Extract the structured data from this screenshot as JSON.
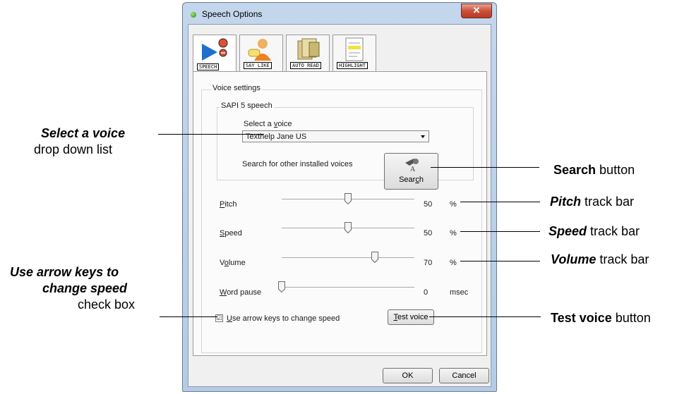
{
  "window": {
    "title": "Speech Options",
    "close_glyph": "✕"
  },
  "tabs": [
    {
      "label": "SPEECH",
      "icon": "speech-tab-icon",
      "active": true
    },
    {
      "label": "SAY LIKE",
      "icon": "say-like-tab-icon",
      "active": false
    },
    {
      "label": "AUTO READ",
      "icon": "auto-read-tab-icon",
      "active": false
    },
    {
      "label": "HIGHLIGHT",
      "icon": "highlight-tab-icon",
      "active": false
    }
  ],
  "voice_settings": {
    "group_label": "Voice settings",
    "sapi_label": "SAPI 5 speech",
    "select_label_pre": "Select a ",
    "select_label_key": "v",
    "select_label_post": "oice",
    "selected_voice": "Texthelp Jane US",
    "search_prompt": "Search for other installed voices",
    "search_button_pre": "Sear",
    "search_button_key": "c",
    "search_button_post": "h"
  },
  "sliders": [
    {
      "key": "P",
      "rest": "itch",
      "value": "50",
      "unit": "%",
      "level_percent": 50
    },
    {
      "key": "S",
      "rest": "peed",
      "value": "50",
      "unit": "%",
      "level_percent": 50
    },
    {
      "pre": "V",
      "key": "o",
      "rest": "lume",
      "value": "70",
      "unit": "%",
      "level_percent": 70
    },
    {
      "key": "W",
      "rest": "ord pause",
      "value": "0",
      "unit": "msec",
      "level_percent": 0
    }
  ],
  "arrow_keys_checkbox": {
    "key": "U",
    "rest": "se arrow keys to change speed",
    "checked": true,
    "mark": "☑"
  },
  "test_voice_button": {
    "key": "T",
    "rest": "est voice"
  },
  "footer": {
    "ok_label": "OK",
    "cancel_label": "Cancel"
  },
  "callouts": {
    "select_voice": {
      "bold": "Select a voice",
      "normal": "drop down list"
    },
    "arrow_keys": {
      "line1": "Use arrow keys to",
      "line2": "change speed",
      "normal": "check box"
    },
    "search": {
      "bold": "Search",
      "normal": " button"
    },
    "pitch": {
      "bold": "Pitch",
      "normal": " track bar"
    },
    "speed": {
      "bold": "Speed",
      "normal": " track bar"
    },
    "volume": {
      "bold": "Volume",
      "normal": " track bar"
    },
    "test_voice": {
      "bold": "Test voice",
      "normal": " button"
    }
  },
  "colors": {
    "frame": "#c4d6ec",
    "close_button": "#c9503a",
    "client": "#f0f0f0"
  }
}
